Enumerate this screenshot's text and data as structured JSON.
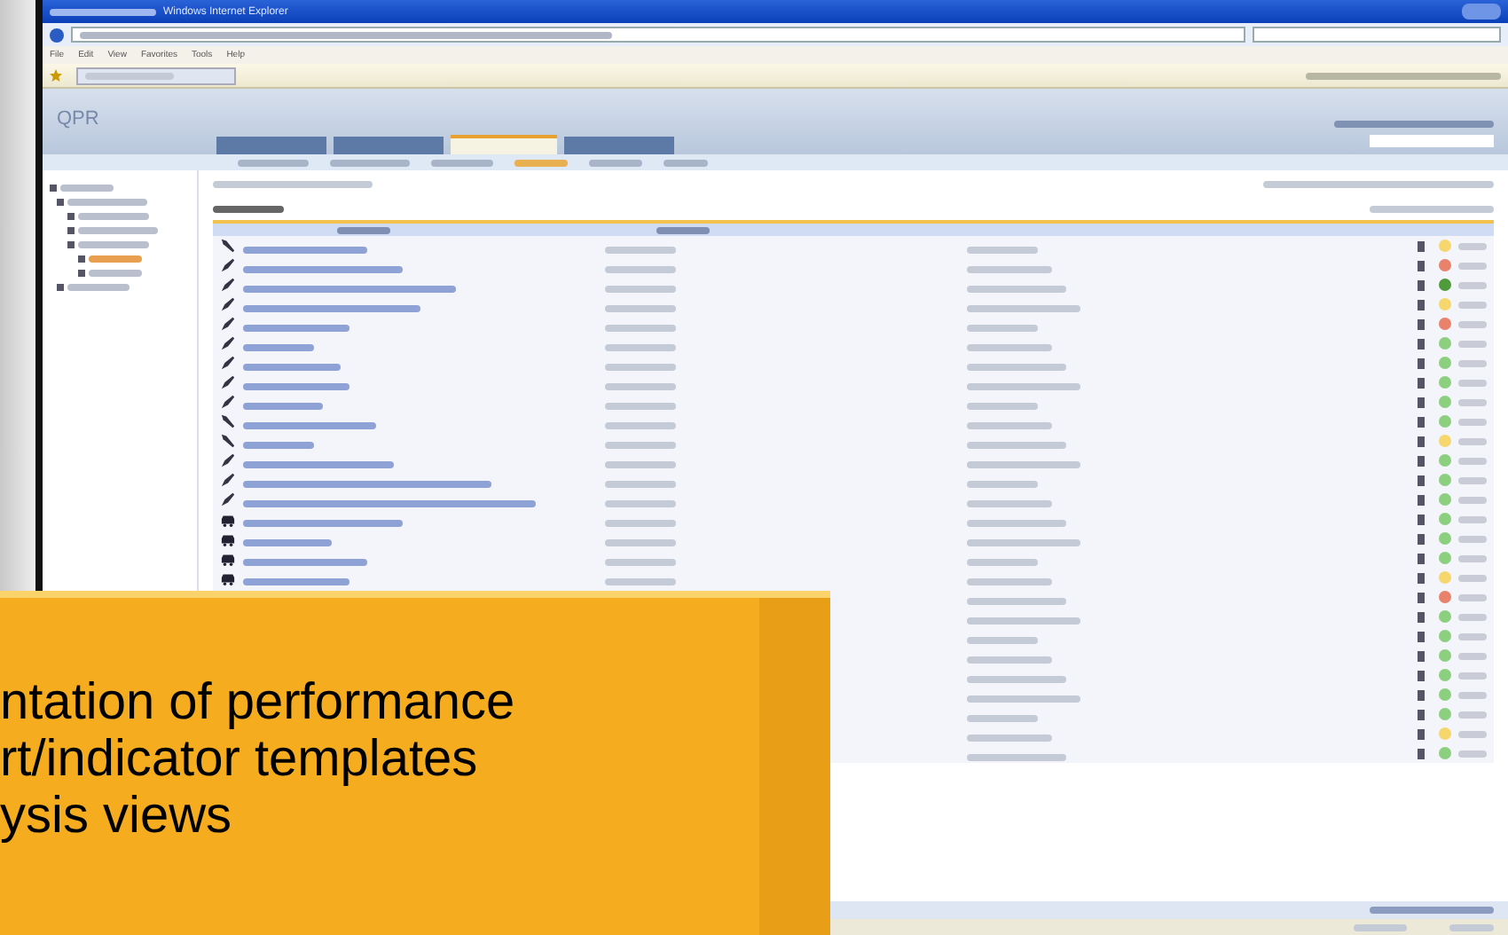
{
  "browser": {
    "title_suffix": "Windows Internet Explorer",
    "menu": [
      "File",
      "Edit",
      "View",
      "Favorites",
      "Tools",
      "Help"
    ]
  },
  "app": {
    "logo": "QPR",
    "tabs": [
      {
        "selected": false
      },
      {
        "selected": false
      },
      {
        "selected": true
      },
      {
        "selected": false
      }
    ]
  },
  "table": {
    "rows": [
      {
        "kind": "wrench",
        "color": "#f5d76e"
      },
      {
        "kind": "meter",
        "color": "#e8826a"
      },
      {
        "kind": "meter",
        "color": "#4f9a3a"
      },
      {
        "kind": "meter",
        "color": "#f5d76e"
      },
      {
        "kind": "meter",
        "color": "#e8826a"
      },
      {
        "kind": "meter",
        "color": "#8ccf7e"
      },
      {
        "kind": "meter",
        "color": "#8ccf7e"
      },
      {
        "kind": "meter",
        "color": "#8ccf7e"
      },
      {
        "kind": "meter",
        "color": "#8ccf7e"
      },
      {
        "kind": "wrench",
        "color": "#8ccf7e"
      },
      {
        "kind": "wrench",
        "color": "#f5d76e"
      },
      {
        "kind": "meter",
        "color": "#8ccf7e"
      },
      {
        "kind": "meter",
        "color": "#8ccf7e"
      },
      {
        "kind": "meter",
        "color": "#8ccf7e"
      },
      {
        "kind": "car",
        "color": "#8ccf7e"
      },
      {
        "kind": "car",
        "color": "#8ccf7e"
      },
      {
        "kind": "car",
        "color": "#8ccf7e"
      },
      {
        "kind": "car",
        "color": "#f5d76e"
      },
      {
        "color": "#e8826a"
      },
      {
        "color": "#8ccf7e"
      },
      {
        "color": "#8ccf7e"
      },
      {
        "color": "#8ccf7e"
      },
      {
        "color": "#8ccf7e"
      },
      {
        "color": "#8ccf7e"
      },
      {
        "color": "#8ccf7e"
      },
      {
        "color": "#f5d76e"
      },
      {
        "color": "#8ccf7e"
      }
    ]
  },
  "callout": {
    "lines": [
      "ntation of performance",
      "rt/indicator templates",
      "ysis views"
    ]
  }
}
